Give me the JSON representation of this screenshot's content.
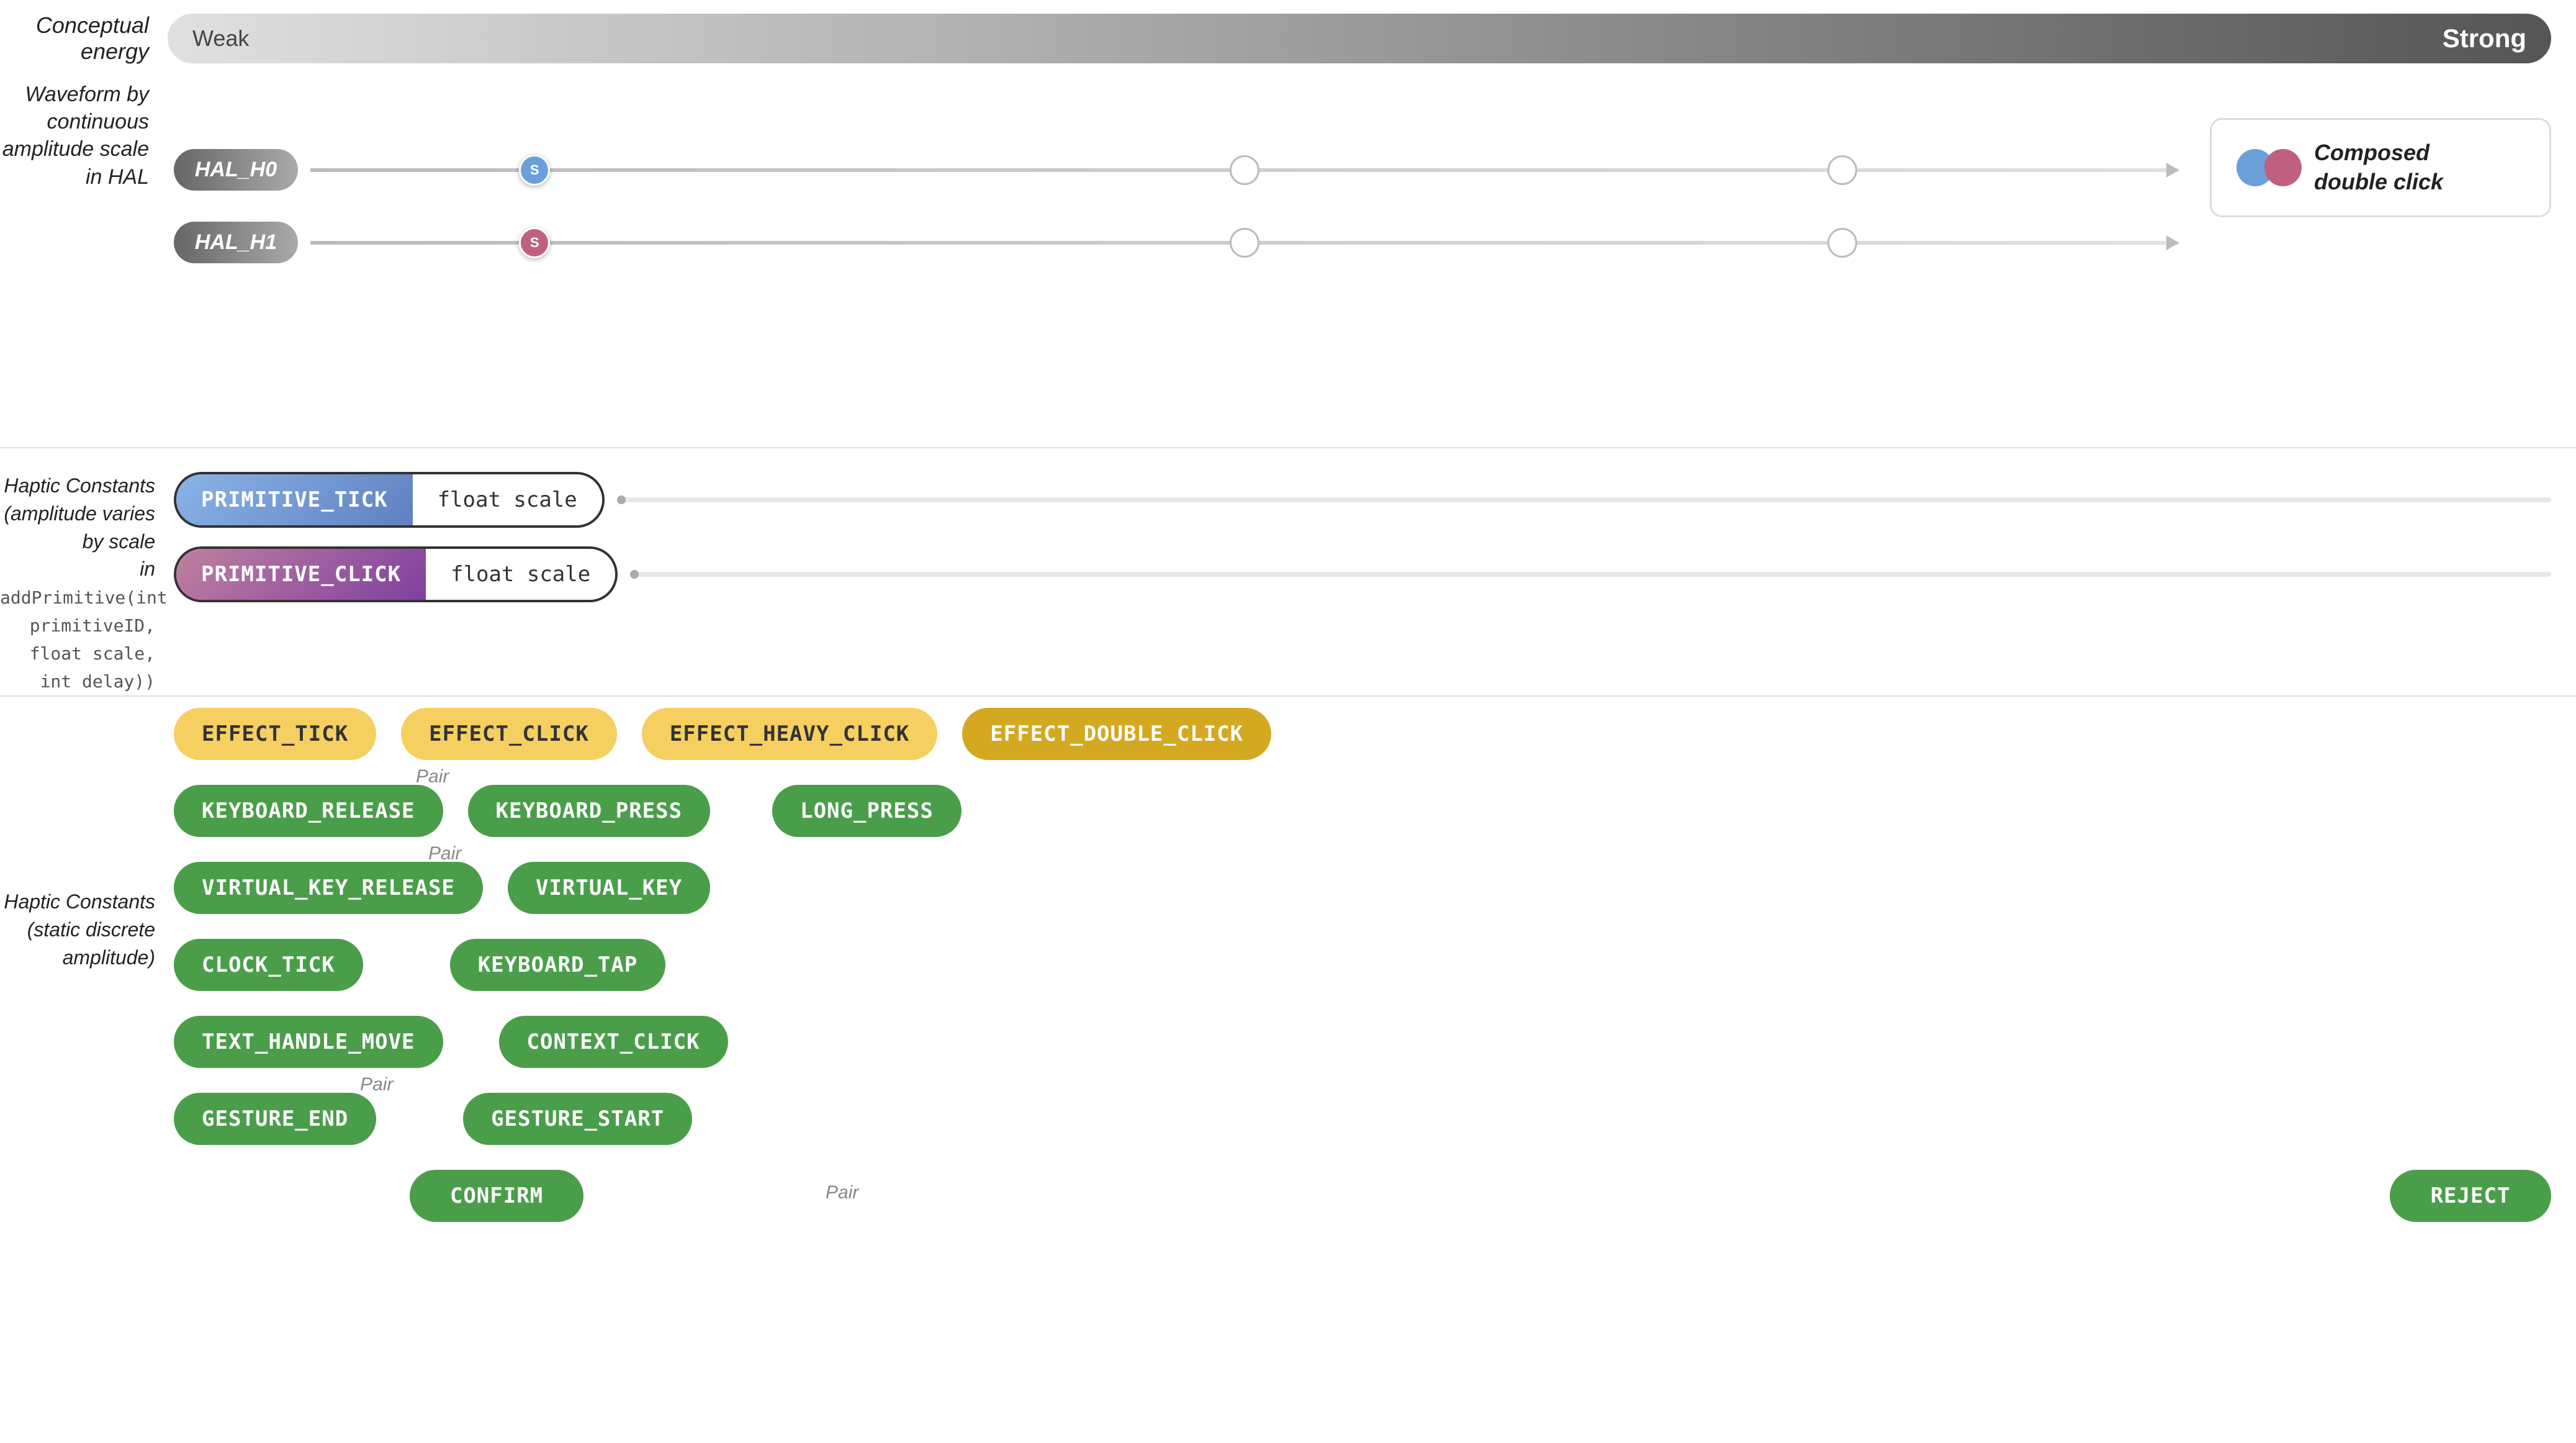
{
  "conceptual": {
    "label": "Conceptual energy",
    "weak": "Weak",
    "strong": "Strong"
  },
  "waveform": {
    "label": "Waveform by continuous\namplitude scale in HAL"
  },
  "hal": {
    "h0": {
      "label": "HAL_H0",
      "dot_label": "S"
    },
    "h1": {
      "label": "HAL_H1",
      "dot_label": "S"
    }
  },
  "composed": {
    "text": "Composed\ndouble click"
  },
  "primitives_label": {
    "line1": "Haptic Constants",
    "line2": "(amplitude varies by scale",
    "line3": "in ",
    "code": "addPrimitive(int primitiveID, float scale, int delay))"
  },
  "primitive_tick": {
    "name": "PRIMITIVE_TICK",
    "param": "float scale"
  },
  "primitive_click": {
    "name": "PRIMITIVE_CLICK",
    "param": "float scale"
  },
  "haptic_constants_label": {
    "line1": "Haptic Constants",
    "line2": "(static discrete",
    "line3": "amplitude)"
  },
  "effects": {
    "row1": [
      {
        "label": "EFFECT_TICK",
        "style": "yellow"
      },
      {
        "label": "EFFECT_CLICK",
        "style": "yellow"
      },
      {
        "label": "EFFECT_HEAVY_CLICK",
        "style": "yellow"
      },
      {
        "label": "EFFECT_DOUBLE_CLICK",
        "style": "yellow-dark"
      }
    ],
    "row2": [
      {
        "label": "KEYBOARD_RELEASE",
        "style": "green",
        "pair": true
      },
      {
        "label": "KEYBOARD_PRESS",
        "style": "green"
      },
      {
        "label": "LONG_PRESS",
        "style": "green"
      }
    ],
    "row3": [
      {
        "label": "VIRTUAL_KEY_RELEASE",
        "style": "green",
        "pair": true
      },
      {
        "label": "VIRTUAL_KEY",
        "style": "green"
      }
    ],
    "row4": [
      {
        "label": "CLOCK_TICK",
        "style": "green"
      },
      {
        "label": "KEYBOARD_TAP",
        "style": "green"
      }
    ],
    "row5": [
      {
        "label": "TEXT_HANDLE_MOVE",
        "style": "green"
      },
      {
        "label": "CONTEXT_CLICK",
        "style": "green"
      }
    ],
    "row6": [
      {
        "label": "GESTURE_END",
        "style": "green",
        "pair": true
      },
      {
        "label": "GESTURE_START",
        "style": "green"
      }
    ],
    "row7": [
      {
        "label": "CONFIRM",
        "style": "green"
      },
      {
        "label": "REJECT",
        "style": "green",
        "pair_label": "Pair",
        "pair_offset": true
      }
    ]
  },
  "pair_label": "Pair"
}
